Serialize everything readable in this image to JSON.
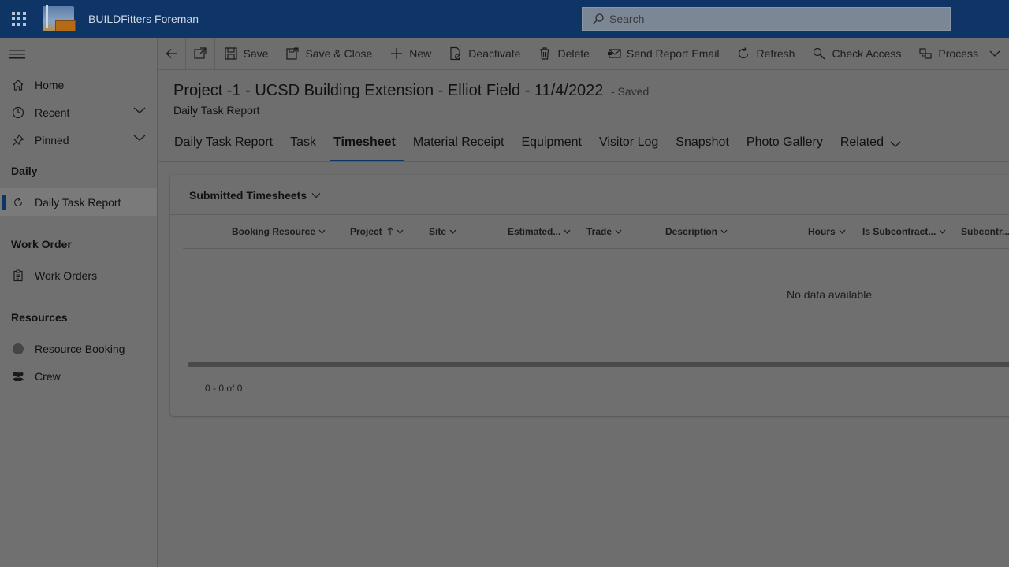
{
  "app": {
    "title": "BUILDFitters Foreman"
  },
  "search": {
    "placeholder": "Search"
  },
  "sidebar": {
    "items": [
      {
        "label": "Home",
        "icon": "home-icon"
      },
      {
        "label": "Recent",
        "icon": "clock-icon"
      },
      {
        "label": "Pinned",
        "icon": "pin-icon"
      }
    ],
    "groups": [
      {
        "title": "Daily",
        "items": [
          {
            "label": "Daily Task Report",
            "icon": "refresh-icon",
            "active": true
          }
        ]
      },
      {
        "title": "Work Order",
        "items": [
          {
            "label": "Work Orders",
            "icon": "clipboard-icon"
          }
        ]
      },
      {
        "title": "Resources",
        "items": [
          {
            "label": "Resource Booking",
            "icon": "avatar-icon"
          },
          {
            "label": "Crew",
            "icon": "people-icon"
          }
        ]
      }
    ]
  },
  "commands": {
    "save": "Save",
    "save_close": "Save & Close",
    "new": "New",
    "deactivate": "Deactivate",
    "delete": "Delete",
    "send_report_email": "Send Report Email",
    "refresh": "Refresh",
    "check_access": "Check Access",
    "process": "Process"
  },
  "record": {
    "title": "Project -1 - UCSD Building Extension - Elliot Field - 11/4/2022",
    "status": "- Saved",
    "entity": "Daily Task Report"
  },
  "tabs": [
    "Daily Task Report",
    "Task",
    "Timesheet",
    "Material Receipt",
    "Equipment",
    "Visitor Log",
    "Snapshot",
    "Photo Gallery",
    "Related"
  ],
  "active_tab": "Timesheet",
  "subgrid": {
    "title": "Submitted Timesheets",
    "columns": [
      "Booking Resource",
      "Project",
      "Site",
      "Estimated...",
      "Trade",
      "Description",
      "Hours",
      "Is Subcontract...",
      "Subcontr..."
    ],
    "empty_message": "No data available",
    "count": "0 - 0 of 0"
  },
  "colors": {
    "header_bg": "#0f3566",
    "overlay_bg": "#6e6e6e",
    "accent": "#0f3566"
  }
}
